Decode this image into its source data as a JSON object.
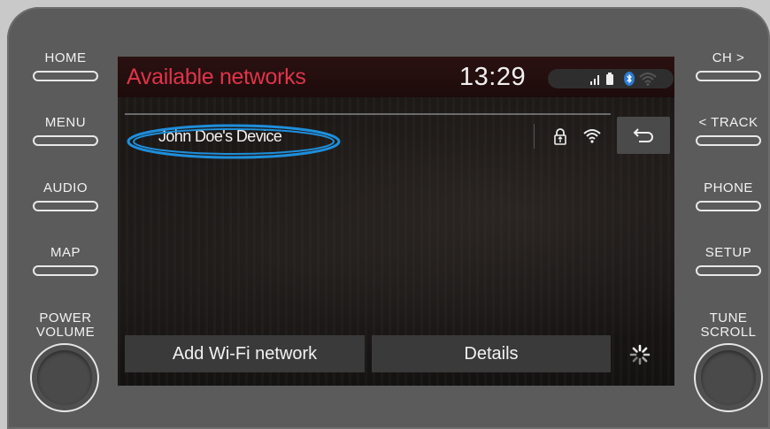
{
  "hardware": {
    "left_buttons": [
      "HOME",
      "MENU",
      "AUDIO",
      "MAP"
    ],
    "left_knob": [
      "POWER",
      "VOLUME"
    ],
    "right_buttons": [
      "CH >",
      "< TRACK",
      "PHONE",
      "SETUP"
    ],
    "right_knob": [
      "TUNE",
      "SCROLL"
    ]
  },
  "screen": {
    "title": "Available networks",
    "clock": "13:29",
    "status_icons": [
      "signal-icon",
      "battery-icon",
      "bluetooth-icon",
      "wifi-icon"
    ],
    "networks": [
      {
        "name": "John Doe's Device",
        "secured": true,
        "icons": [
          "lock-icon",
          "wifi-icon"
        ]
      }
    ],
    "buttons": {
      "add": "Add Wi-Fi network",
      "details": "Details"
    },
    "icons": {
      "back": "back-arrow-icon",
      "loading": "loading-spinner-icon"
    },
    "colors": {
      "title": "#e0344a",
      "highlight": "#1e8fdc",
      "bluetooth": "#2a7bd6"
    }
  }
}
